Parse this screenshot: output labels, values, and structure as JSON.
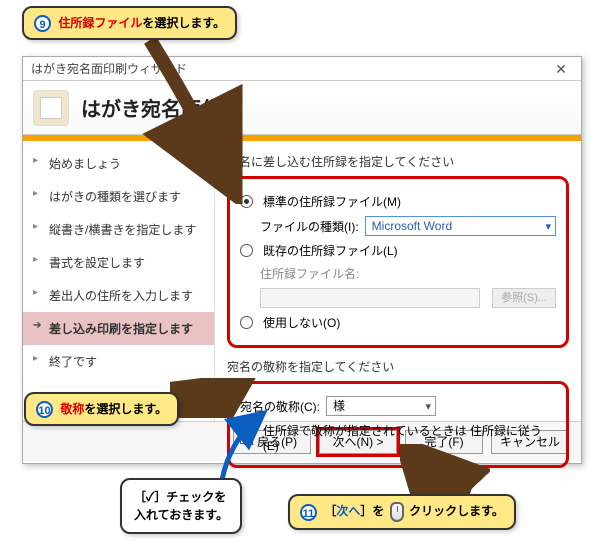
{
  "callouts": {
    "c9": {
      "num": "9",
      "red": "住所録ファイル",
      "rest": "を選択します。"
    },
    "c10": {
      "num": "10",
      "red": "敬称",
      "rest": "を選択します。"
    },
    "c11": {
      "num": "11",
      "pre": "［",
      "blue": "次へ",
      "post": "］を",
      "rest": "クリックします。"
    },
    "hint": {
      "l1a": "［",
      "l1b": "✓",
      "l1c": "］チェックを",
      "l2": "入れておきます。"
    }
  },
  "window": {
    "title": "はがき宛名面印刷ウィザード",
    "header": "はがき宛名面作成",
    "sidebar": [
      {
        "label": "始めましょう"
      },
      {
        "label": "はがきの種類を選びます"
      },
      {
        "label": "縦書き/横書きを指定します"
      },
      {
        "label": "書式を設定します"
      },
      {
        "label": "差出人の住所を入力します"
      },
      {
        "label": "差し込み印刷を指定します",
        "active": true
      },
      {
        "label": "終了です"
      }
    ],
    "content": {
      "section1_title": "宛名に差し込む住所録を指定してください",
      "opt_std": "標準の住所録ファイル(M)",
      "file_type_label": "ファイルの種類(I):",
      "file_type_value": "Microsoft Word",
      "opt_exist": "既存の住所録ファイル(L)",
      "exist_name_label": "住所録ファイル名:",
      "browse_btn": "参照(S)...",
      "opt_none": "使用しない(O)",
      "section2_title": "宛名の敬称を指定してください",
      "suffix_label": "宛名の敬称(C):",
      "suffix_value": "様",
      "follow_label": "住所録で敬称が指定されているときは 住所録に従う(E)"
    },
    "footer": {
      "back": "< 戻る(P)",
      "next": "次へ(N) >",
      "finish": "完了(F)",
      "cancel": "キャンセル"
    }
  }
}
